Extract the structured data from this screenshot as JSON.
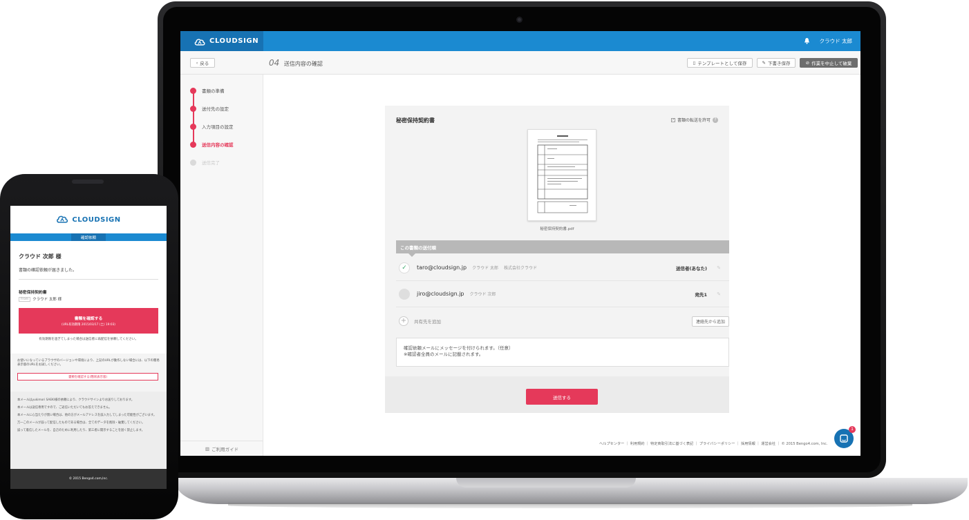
{
  "app": {
    "brand": "CLOUDSIGN",
    "user_name": "クラウド 太郎",
    "bell_icon": "bell-icon"
  },
  "toolbar": {
    "back_label": "戻る",
    "step_number": "04",
    "step_title": "送信内容の確認",
    "save_template_label": "テンプレートとして保存",
    "save_draft_label": "下書き保存",
    "abort_label": "作業を中止して破棄"
  },
  "sidebar": {
    "steps": [
      {
        "label": "書類の準備",
        "state": "done"
      },
      {
        "label": "送付先の設定",
        "state": "done"
      },
      {
        "label": "入力項目の設定",
        "state": "done"
      },
      {
        "label": "送信内容の確認",
        "state": "current"
      },
      {
        "label": "送信完了",
        "state": "pending"
      }
    ],
    "guide_label": "ご利用ガイド"
  },
  "document": {
    "title": "秘密保持契約書",
    "allow_transfer_label": "書類の転送を許可",
    "file_name": "秘密保持契約書.pdf"
  },
  "recipients": {
    "section_label": "この書類の送付順",
    "items": [
      {
        "email": "taro@cloudsign.jp",
        "name": "クラウド 太郎",
        "company": "株式会社クラウド",
        "role": "送信者(あなた)",
        "status": "done"
      },
      {
        "email": "jiro@cloudsign.jp",
        "name": "クラウド 次郎",
        "company": "",
        "role": "宛先1",
        "status": "waiting"
      }
    ],
    "add_cc_label": "共有先を追加",
    "from_contacts_label": "連絡先から追加"
  },
  "message": {
    "line1": "確認依頼メールにメッセージを付けられます。（任意）",
    "line2": "※確認者全員のメールに記載されます。"
  },
  "send_label": "送信する",
  "footer": {
    "links": "ヘルプセンター ｜ 利用規約 ｜ 特定商取引法に基づく表記 ｜ プライバシーポリシー ｜ 採用情報 ｜ 運営会社 ｜ © 2015 Bengo4.com, Inc.",
    "chat_badge": "1"
  },
  "phone": {
    "brand": "CLOUDSIGN",
    "band_label": "確認依頼",
    "recipient": "クラウド 次郎 様",
    "notice": "書類の確認依頼が届きました。",
    "doc_title": "秘密保持契約書",
    "from_tag": "From",
    "from_name": "クラウド 太郎 様",
    "cta_line1": "書類を確認する",
    "cta_line2": "(URL有効期限 2015/03/17 (土) 19:03)",
    "expired_note": "有効期限を過ぎてしまった場合は送信者に再配信を依頼してください。",
    "legacy_text": "お使いになっているブラウザのバージョンや環境により、上記のURLが動作しない場合には、以下の簡易表示版のURLをお試しください。",
    "legacy_button": "書類を確認する(簡易表示版)",
    "notes": [
      "本メールはyukimori SAEKI様の依頼により、クラウドサインよりお送りしております。",
      "本メールは送信専用ですので、ご返信いただいてもお答えできません。",
      "本メールに心当たりが無い場合は、他の方がメールアドレスを誤入力してしまった可能性がございます。",
      "万一このメールが誤って配信したものである場合は、全てのデータを削除・破棄してください。",
      "誤って着信したメールを、自己のために利用したり、第三者に開示することを固く禁止します。"
    ],
    "copyright": "© 2015 Bengo4.com,Inc."
  }
}
